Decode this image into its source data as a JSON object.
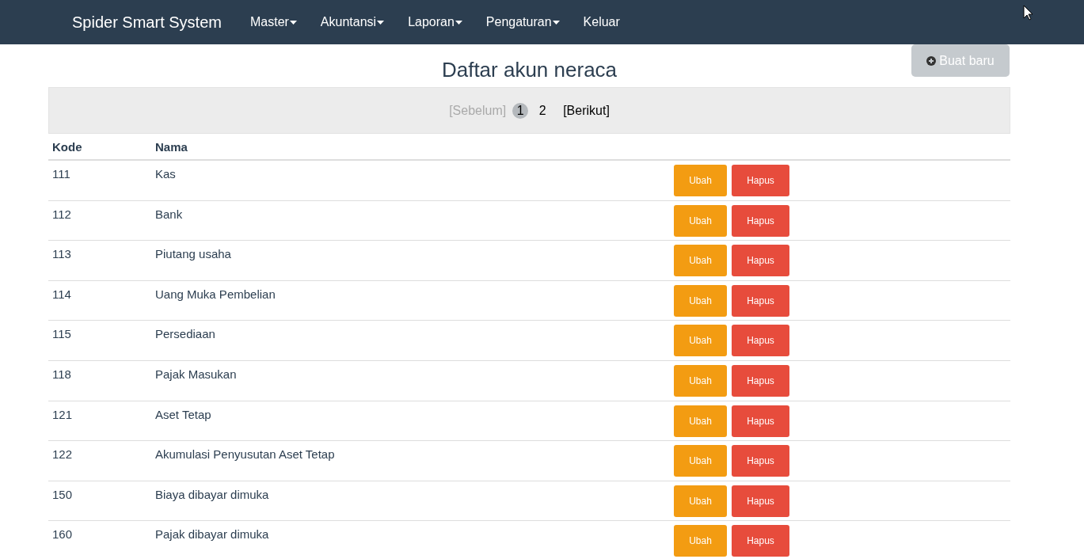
{
  "navbar": {
    "brand": "Spider Smart System",
    "menu": [
      {
        "label": "Master",
        "dropdown": true
      },
      {
        "label": "Akuntansi",
        "dropdown": true
      },
      {
        "label": "Laporan",
        "dropdown": true
      },
      {
        "label": "Pengaturan",
        "dropdown": true
      },
      {
        "label": "Keluar",
        "dropdown": false
      }
    ]
  },
  "page": {
    "title": "Daftar akun neraca",
    "create_button": "Buat baru"
  },
  "pagination": {
    "previous": {
      "label": "[Sebelum]",
      "disabled": true
    },
    "pages": [
      {
        "label": "1",
        "selected": true
      },
      {
        "label": "2",
        "selected": false
      }
    ],
    "next": {
      "label": "[Berikut]",
      "disabled": false
    }
  },
  "table": {
    "columns": [
      "Kode",
      "Nama"
    ],
    "rows": [
      {
        "code": "111",
        "name": "Kas",
        "edit": "Ubah",
        "delete": "Hapus"
      },
      {
        "code": "112",
        "name": "Bank",
        "edit": "Ubah",
        "delete": "Hapus"
      },
      {
        "code": "113",
        "name": "Piutang usaha",
        "edit": "Ubah",
        "delete": "Hapus"
      },
      {
        "code": "114",
        "name": "Uang Muka Pembelian",
        "edit": "Ubah",
        "delete": "Hapus"
      },
      {
        "code": "115",
        "name": "Persediaan",
        "edit": "Ubah",
        "delete": "Hapus"
      },
      {
        "code": "118",
        "name": "Pajak Masukan",
        "edit": "Ubah",
        "delete": "Hapus"
      },
      {
        "code": "121",
        "name": "Aset Tetap",
        "edit": "Ubah",
        "delete": "Hapus"
      },
      {
        "code": "122",
        "name": "Akumulasi Penyusutan Aset Tetap",
        "edit": "Ubah",
        "delete": "Hapus"
      },
      {
        "code": "150",
        "name": "Biaya dibayar dimuka",
        "edit": "Ubah",
        "delete": "Hapus"
      },
      {
        "code": "160",
        "name": "Pajak dibayar dimuka",
        "edit": "Ubah",
        "delete": "Hapus"
      }
    ]
  }
}
